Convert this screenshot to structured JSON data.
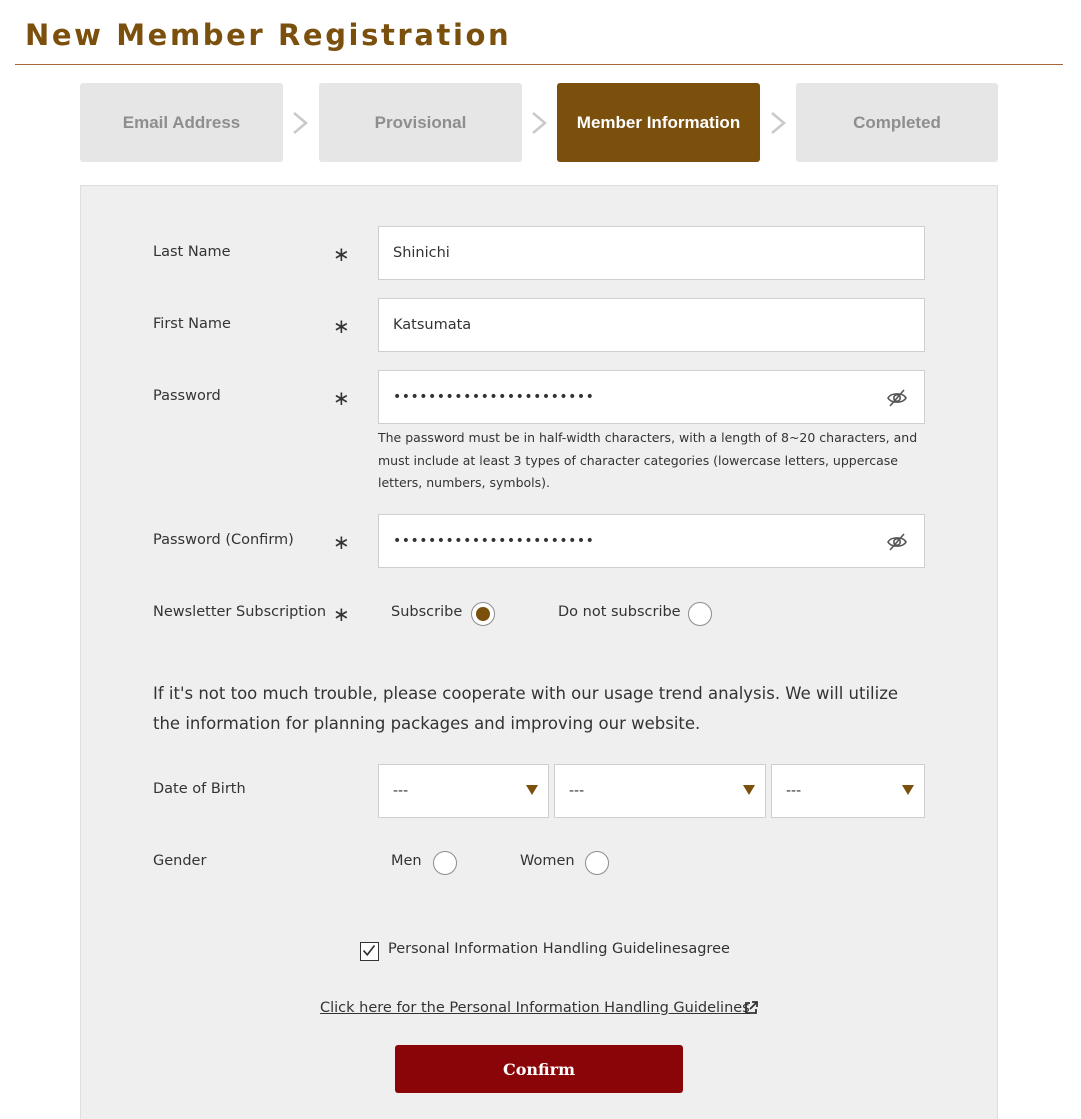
{
  "page": {
    "title": "New Member Registration"
  },
  "steps": [
    {
      "label": "Email Address",
      "active": false
    },
    {
      "label": "Provisional",
      "active": false
    },
    {
      "label": "Member Information",
      "active": true
    },
    {
      "label": "Completed",
      "active": false
    }
  ],
  "form": {
    "required_mark": "∗",
    "last_name": {
      "label": "Last Name",
      "value": "Shinichi"
    },
    "first_name": {
      "label": "First Name",
      "value": "Katsumata"
    },
    "password": {
      "label": "Password",
      "value_masked": "•••••••••••••••••••••••",
      "help": "The password must be in half-width characters, with a length of 8~20 characters, and must include at least 3 types of character categories (lowercase letters, uppercase letters, numbers, symbols).",
      "toggle_icon": "eye-slash-icon"
    },
    "password_confirm": {
      "label": "Password (Confirm)",
      "value_masked": "•••••••••••••••••••••••",
      "toggle_icon": "eye-slash-icon"
    },
    "newsletter": {
      "label": "Newsletter Subscription",
      "options": [
        {
          "label": "Subscribe",
          "checked": true
        },
        {
          "label": "Do not subscribe",
          "checked": false
        }
      ]
    },
    "intro": "If it's not too much trouble, please cooperate with our usage trend analysis. We will utilize the information for planning packages and improving our website.",
    "dob": {
      "label": "Date of Birth",
      "year": "---",
      "month": "---",
      "day": "---"
    },
    "gender": {
      "label": "Gender",
      "options": [
        {
          "label": "Men",
          "checked": false
        },
        {
          "label": "Women",
          "checked": false
        }
      ]
    },
    "agree": {
      "label": "Personal Information Handling Guidelinesagree",
      "checked": true
    },
    "guidelines_link": "Click here for the Personal Information Handling Guidelines",
    "confirm_label": "Confirm"
  },
  "colors": {
    "brand_brown": "#7b4f0c",
    "confirm_red": "#8a0507",
    "panel_bg": "#efefef",
    "step_inactive": "#e6e6e6"
  }
}
